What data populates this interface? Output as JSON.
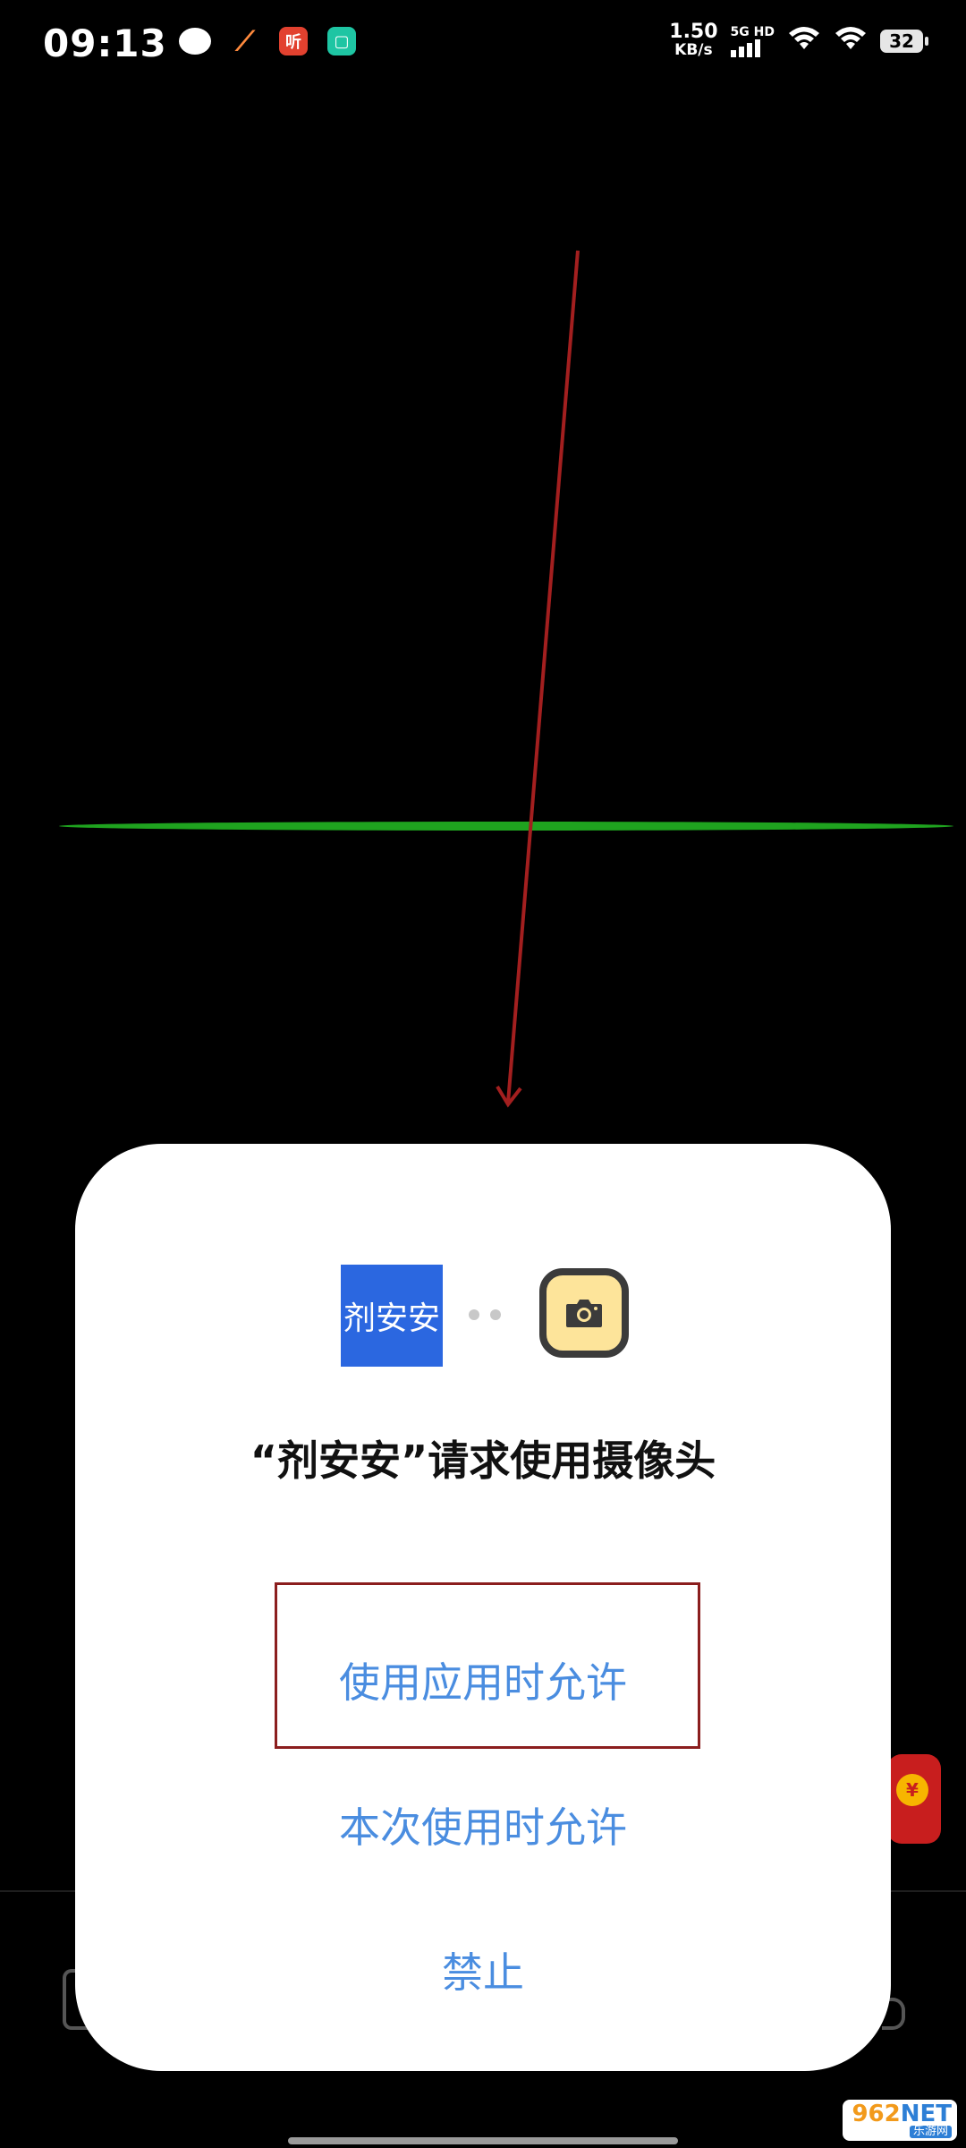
{
  "status_bar": {
    "time": "09:13",
    "net_speed_value": "1.50",
    "net_speed_unit": "KB/s",
    "network_label": "5G HD",
    "battery": "32",
    "notification_icons": [
      "chat-bubble-icon",
      "orange-app-icon",
      "listen-app-icon",
      "mi-home-icon"
    ],
    "listen_icon_text": "听"
  },
  "dialog": {
    "app_logo_text": "剂安安",
    "title": "“剂安安”请求使用摄像头",
    "option_allow_while_using": "使用应用时允许",
    "option_allow_once": "本次使用时允许",
    "option_deny": "禁止",
    "option_color": "#4a8de0",
    "app_logo_color": "#2b67e0"
  },
  "background": {
    "level_line_color": "#1fa31f",
    "annotation_arrow_color": "#a31f1f"
  },
  "watermark": {
    "top_num": "962",
    "top_suffix": "NET",
    "bottom": "乐游网"
  }
}
